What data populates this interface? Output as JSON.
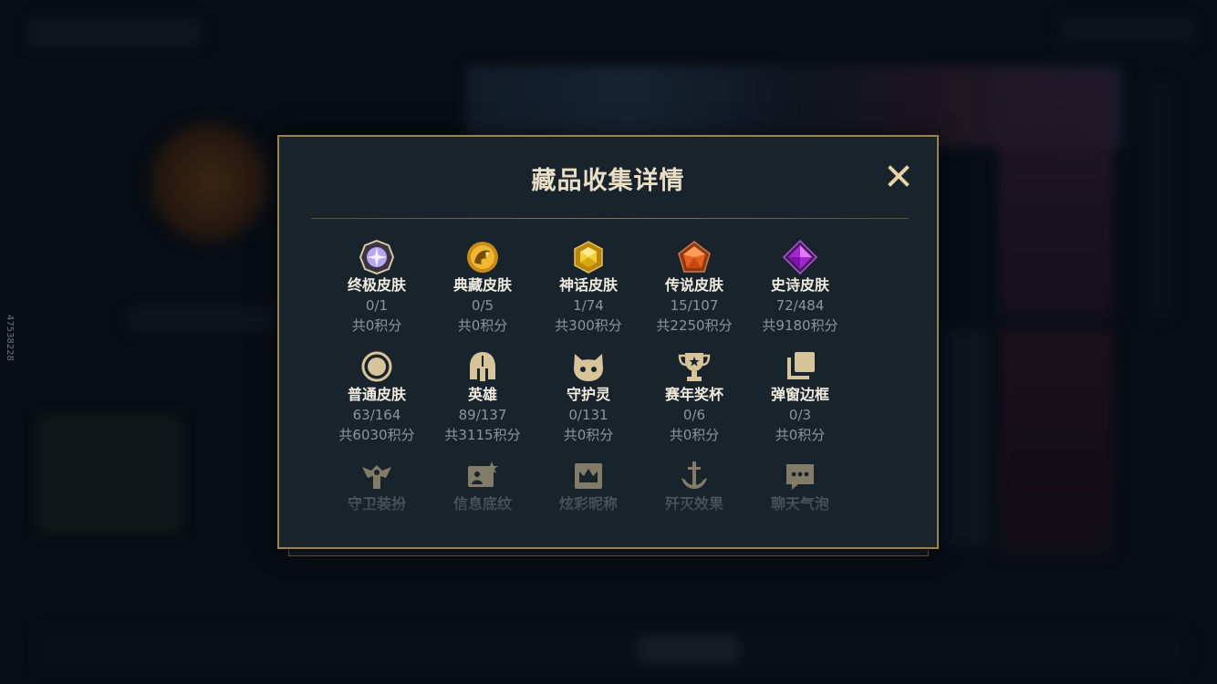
{
  "watermark": "47538228",
  "modal": {
    "title": "藏品收集详情",
    "close_icon": "close-icon",
    "items": [
      {
        "label": "终极皮肤",
        "count": "0/1",
        "points": "共0积分",
        "icon": "ultimate-gem-icon"
      },
      {
        "label": "典藏皮肤",
        "count": "0/5",
        "points": "共0积分",
        "icon": "dragon-emblem-icon"
      },
      {
        "label": "神话皮肤",
        "count": "1/74",
        "points": "共300积分",
        "icon": "mythic-gem-icon"
      },
      {
        "label": "传说皮肤",
        "count": "15/107",
        "points": "共2250积分",
        "icon": "legendary-gem-icon"
      },
      {
        "label": "史诗皮肤",
        "count": "72/484",
        "points": "共9180积分",
        "icon": "epic-gem-icon"
      },
      {
        "label": "普通皮肤",
        "count": "63/164",
        "points": "共6030积分",
        "icon": "ring-icon"
      },
      {
        "label": "英雄",
        "count": "89/137",
        "points": "共3115积分",
        "icon": "helmet-icon"
      },
      {
        "label": "守护灵",
        "count": "0/131",
        "points": "共0积分",
        "icon": "guardian-face-icon"
      },
      {
        "label": "赛年奖杯",
        "count": "0/6",
        "points": "共0积分",
        "icon": "trophy-icon"
      },
      {
        "label": "弹窗边框",
        "count": "0/3",
        "points": "共0积分",
        "icon": "stacked-frames-icon"
      },
      {
        "label": "守卫装扮",
        "icon": "ward-icon"
      },
      {
        "label": "信息底纹",
        "icon": "profile-card-icon"
      },
      {
        "label": "炫彩昵称",
        "icon": "crown-frame-icon"
      },
      {
        "label": "歼灭效果",
        "icon": "anchor-icon"
      },
      {
        "label": "聊天气泡",
        "icon": "chat-bubble-icon"
      }
    ]
  },
  "colors": {
    "modal_bg": "#19232c",
    "gold_border": "#9a8257",
    "title_text": "#eadfc6",
    "label_text": "#f1ece0",
    "muted_text": "#8c959c",
    "icon_gold": "#d8c49a"
  }
}
